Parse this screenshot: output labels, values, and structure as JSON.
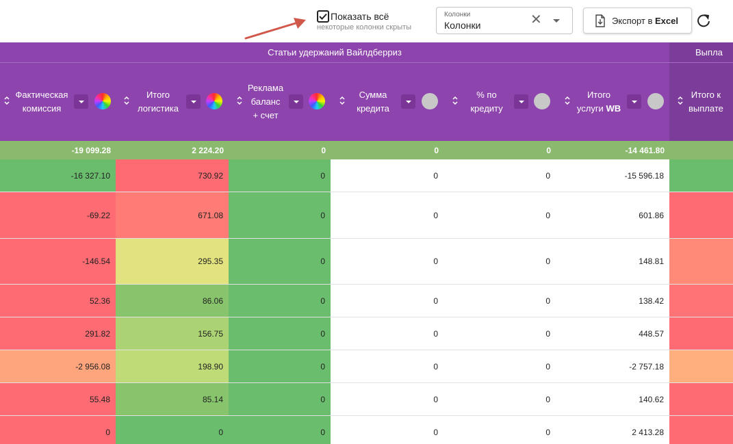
{
  "toolbar": {
    "show_all_label": "Показать всё",
    "show_all_sub": "некоторые колонки скрыты",
    "show_all_checked": true,
    "columns_caption": "Колонки",
    "columns_value": "Колонки",
    "export_prefix": "Экспорт в ",
    "export_bold": "Excel"
  },
  "header": {
    "group_main": "Статьи удержаний Вайлдберриз",
    "group_pay": "Выпла",
    "columns": [
      {
        "line1": "Фактическая",
        "line2": "комиссия",
        "line3": "",
        "indicator": "wheel"
      },
      {
        "line1": "Итого",
        "line2": "логистика",
        "line3": "",
        "indicator": "wheel"
      },
      {
        "line1": "Реклама",
        "line2": "баланс",
        "line3": "+ счет",
        "indicator": "wheel"
      },
      {
        "line1": "Сумма",
        "line2": "кредита",
        "line3": "",
        "indicator": "gray"
      },
      {
        "line1": "% по",
        "line2": "кредиту",
        "line3": "",
        "indicator": "gray"
      },
      {
        "line1": "Итого",
        "line2": "услуги ",
        "line2_bold": "WB",
        "indicator": "gray"
      },
      {
        "line1": "Итого к",
        "line2": "выплате"
      }
    ]
  },
  "totals": [
    "-19 099.28",
    "2 224.20",
    "0",
    "0",
    "0",
    "-14 461.80"
  ],
  "rows": [
    {
      "values": [
        "-16 327.10",
        "730.92",
        "0",
        "0",
        "0",
        "-15 596.18"
      ],
      "colors": [
        "#6abd6d",
        "#ff6b73",
        "#6abd6d",
        "#ffffff",
        "#ffffff",
        "#ffffff",
        "#6abd6d"
      ]
    },
    {
      "values": [
        "-69.22",
        "671.08",
        "0",
        "0",
        "0",
        "601.86"
      ],
      "colors": [
        "#ff6b73",
        "#ff7c76",
        "#6abd6d",
        "#ffffff",
        "#ffffff",
        "#ffffff",
        "#ff6b73"
      ]
    },
    {
      "values": [
        "-146.54",
        "295.35",
        "0",
        "0",
        "0",
        "148.81"
      ],
      "colors": [
        "#ff6b73",
        "#e2e27e",
        "#6abd6d",
        "#ffffff",
        "#ffffff",
        "#ffffff",
        "#ff8a78"
      ]
    },
    {
      "values": [
        "52.36",
        "86.06",
        "0",
        "0",
        "0",
        "138.42"
      ],
      "colors": [
        "#ff6b73",
        "#88c46c",
        "#6abd6d",
        "#ffffff",
        "#ffffff",
        "#ffffff",
        "#ff7275"
      ]
    },
    {
      "values": [
        "291.82",
        "156.75",
        "0",
        "0",
        "0",
        "448.57"
      ],
      "colors": [
        "#ff6b73",
        "#acd373",
        "#6abd6d",
        "#ffffff",
        "#ffffff",
        "#ffffff",
        "#ff6b73"
      ]
    },
    {
      "values": [
        "-2 956.08",
        "198.90",
        "0",
        "0",
        "0",
        "-2 757.18"
      ],
      "colors": [
        "#ffa57d",
        "#bedb77",
        "#6abd6d",
        "#ffffff",
        "#ffffff",
        "#ffffff",
        "#ffae7e"
      ]
    },
    {
      "values": [
        "55.48",
        "85.14",
        "0",
        "0",
        "0",
        "140.62"
      ],
      "colors": [
        "#ff6b73",
        "#88c46c",
        "#6abd6d",
        "#ffffff",
        "#ffffff",
        "#ffffff",
        "#ff6b73"
      ]
    },
    {
      "values": [
        "0",
        "0",
        "0",
        "0",
        "0",
        "2 413.28"
      ],
      "colors": [
        "#ff6b73",
        "#6abd6d",
        "#6abd6d",
        "#ffffff",
        "#ffffff",
        "#ffffff",
        "#ff6b73"
      ]
    }
  ]
}
